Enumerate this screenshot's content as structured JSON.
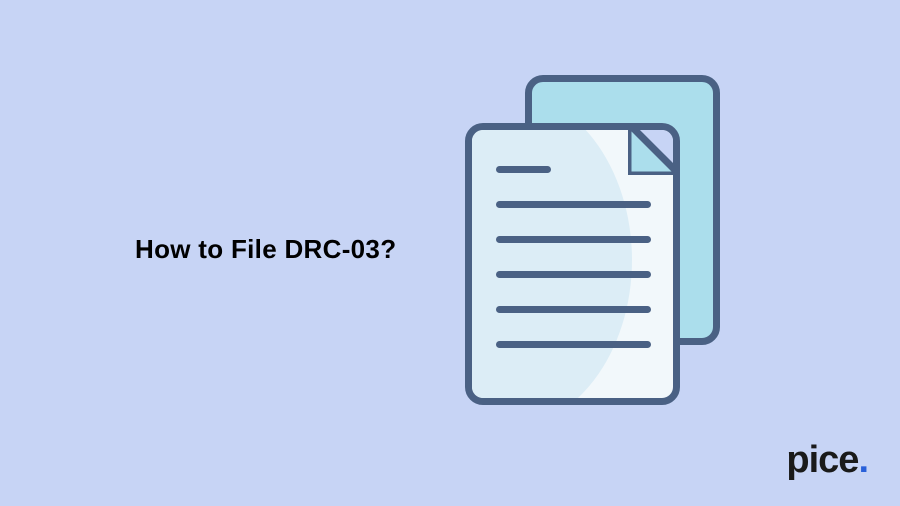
{
  "heading": "How to File DRC-03?",
  "brand": {
    "name": "pice",
    "dot": "."
  },
  "colors": {
    "background": "#c7d4f5",
    "docStroke": "#4a6184",
    "docBack": "#abdeec",
    "docFront": "#f2f8fb",
    "docCurve": "#dcedf6",
    "brandDot": "#2960d9"
  }
}
